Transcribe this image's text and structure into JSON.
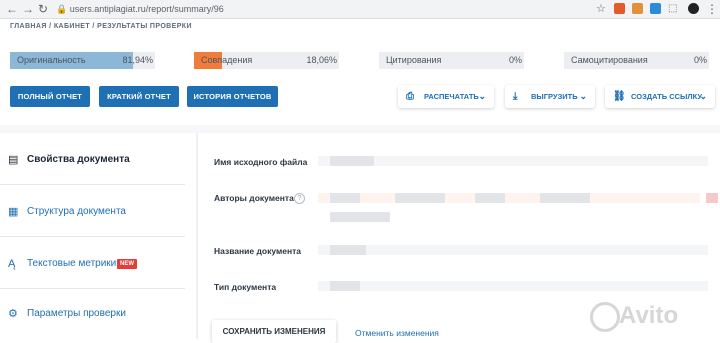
{
  "browser": {
    "url": "users.antiplagiat.ru/report/summary/96",
    "back_glyph": "←",
    "forward_glyph": "→",
    "reload_glyph": "↻",
    "star_glyph": "☆"
  },
  "breadcrumb": {
    "home": "ГЛАВНАЯ",
    "sep": "/",
    "cabinet": "КАБИНЕТ",
    "current": "РЕЗУЛЬТАТЫ ПРОВЕРКИ"
  },
  "metrics": [
    {
      "label": "Оригинальность",
      "value": "81,94%",
      "fill": 0.85,
      "color": "#8db7d7"
    },
    {
      "label": "Совпадения",
      "value": "18,06%",
      "fill": 0.19,
      "color": "#f07c3c"
    },
    {
      "label": "Цитирования",
      "value": "0%",
      "fill": 0,
      "color": "#cccccc"
    },
    {
      "label": "Самоцитирования",
      "value": "0%",
      "fill": 0,
      "color": "#cccccc"
    }
  ],
  "report_buttons": {
    "full": "ПОЛНЫЙ ОТЧЕТ",
    "short": "КРАТКИЙ ОТЧЕТ",
    "history": "ИСТОРИЯ ОТЧЕТОВ"
  },
  "action_buttons": {
    "print": "РАСПЕЧАТАТЬ",
    "export": "ВЫГРУЗИТЬ",
    "link": "СОЗДАТЬ ССЫЛКУ",
    "chevron": "⌄"
  },
  "sidebar": {
    "items": [
      {
        "label": "Свойства документа",
        "icon": "document-icon"
      },
      {
        "label": "Структура документа",
        "icon": "structure-icon"
      },
      {
        "label": "Текстовые метрики",
        "icon": "metrics-icon",
        "badge": "NEW"
      },
      {
        "label": "Параметры проверки",
        "icon": "gear-icon"
      }
    ]
  },
  "form": {
    "file_name_label": "Имя исходного файла",
    "authors_label": "Авторы документа",
    "help_glyph": "?",
    "title_label": "Название документа",
    "type_label": "Тип документа",
    "save": "СОХРАНИТЬ ИЗМЕНЕНИЯ",
    "cancel": "Отменить изменения"
  },
  "watermark": "Avito"
}
